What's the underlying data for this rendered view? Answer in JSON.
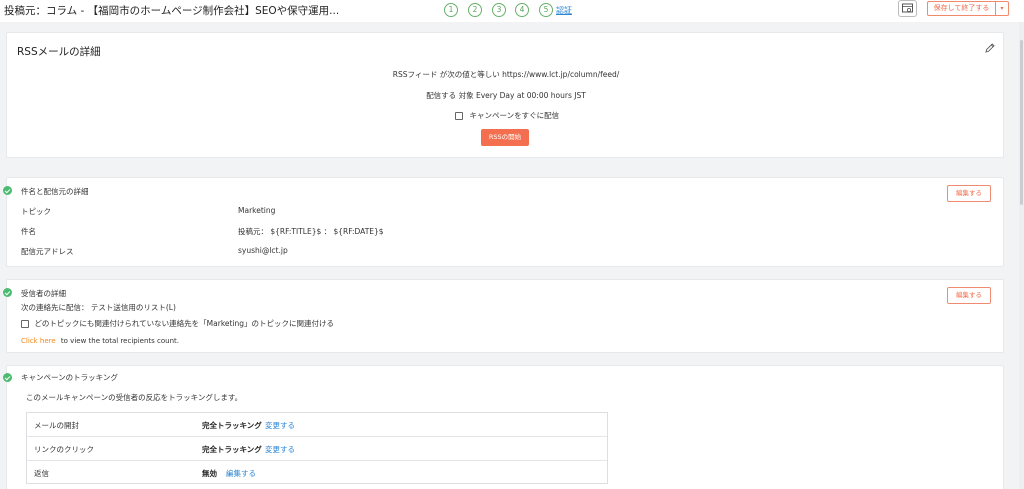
{
  "header": {
    "title": "投稿元：コラム - 【福岡市のホームページ制作会社】SEOや保守運用...",
    "steps": [
      "1",
      "2",
      "3",
      "4",
      "5"
    ],
    "step_link": "認証",
    "save_label": "保存して終了する",
    "save_dropdown": "▾"
  },
  "rss": {
    "title": "RSSメールの詳細",
    "feed_line": "RSSフィード が次の値と等しい https://www.lct.jp/column/feed/",
    "schedule_line": "配信する 対象 Every Day at 00:00 hours JST",
    "send_now_label": "キャンペーンをすぐに配信",
    "start_button": "RSSの開始"
  },
  "subject_section": {
    "title": "件名と配信元の詳細",
    "edit_label": "編集する",
    "rows": [
      {
        "label": "トピック",
        "value": "Marketing"
      },
      {
        "label": "件名",
        "value": "投稿元： ${RF:TITLE}$ ： ${RF:DATE}$"
      },
      {
        "label": "配信元アドレス",
        "value": "syushi@lct.jp"
      }
    ]
  },
  "recipients_section": {
    "title": "受信者の詳細",
    "edit_label": "編集する",
    "list_line": "次の連絡先に配信： テスト送信用のリスト(L)",
    "checkbox_label": "どのトピックにも関連付けられていない連絡先を「Marketing」のトピックに関連付ける",
    "click_here": "Click here",
    "count_text": "to view the total recipients count."
  },
  "tracking_section": {
    "title": "キャンペーンのトラッキング",
    "description": "このメールキャンペーンの受信者の反応をトラッキングします。",
    "rows": [
      {
        "label": "メールの開封",
        "status": "完全トラッキング",
        "link": "変更する"
      },
      {
        "label": "リンクのクリック",
        "status": "完全トラッキング",
        "link": "変更する"
      },
      {
        "label": "返信",
        "status": "無効",
        "link": "編集する"
      }
    ]
  },
  "colors": {
    "accent": "#f46f4f",
    "success": "#4cbb71",
    "link": "#2b86d4",
    "orange_link": "#f0891d"
  }
}
